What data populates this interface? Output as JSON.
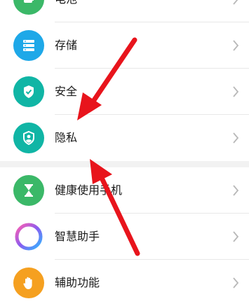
{
  "settings": {
    "items": [
      {
        "label": "电池",
        "icon": "battery-icon",
        "color": "#3bb868"
      },
      {
        "label": "存储",
        "icon": "storage-icon",
        "color": "#1ea8e8"
      },
      {
        "label": "安全",
        "icon": "shield-icon",
        "color": "#10b5a5"
      },
      {
        "label": "隐私",
        "icon": "privacy-icon",
        "color": "#10b5a5"
      },
      {
        "label": "健康使用手机",
        "icon": "hourglass-icon",
        "color": "#3bb868"
      },
      {
        "label": "智慧助手",
        "icon": "assistant-ring-icon",
        "color": "#8a5cf0"
      },
      {
        "label": "辅助功能",
        "icon": "hand-icon",
        "color": "#f5a020"
      }
    ]
  },
  "annotation_color": "#e8141c"
}
